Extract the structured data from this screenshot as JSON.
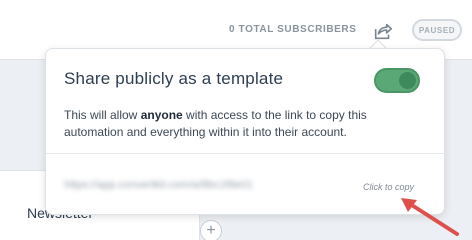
{
  "header": {
    "subscribers_label": "0 TOTAL SUBSCRIBERS",
    "share_icon": "share-icon",
    "status_badge": "PAUSED"
  },
  "popover": {
    "title": "Share publicly as a template",
    "toggle_state": "on",
    "description_before": "This will allow ",
    "description_emphasis": "anyone",
    "description_after": " with access to the link to copy this automation and everything within it into their account.",
    "link_text": "https://app.convertkit.com/a/8bc1f8e01",
    "copy_label": "Click to copy"
  },
  "background": {
    "card_title": "Newsletter",
    "add_icon": "+"
  },
  "colors": {
    "toggle_on": "#5aa876",
    "annotation_arrow": "#e0504a"
  }
}
